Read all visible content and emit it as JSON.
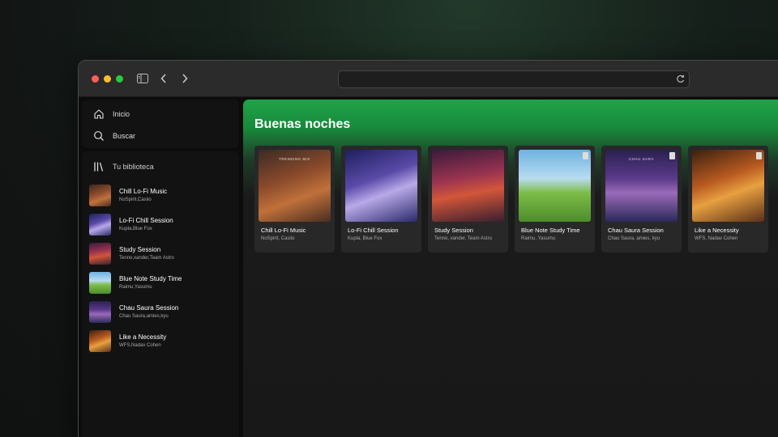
{
  "nav": {
    "home_label": "Inicio",
    "search_label": "Buscar"
  },
  "library": {
    "title": "Tu biblioteca",
    "items": [
      {
        "title": "Chill Lo-Fi Music",
        "subtitle": "NoSpirit,Casiio",
        "art": "art1"
      },
      {
        "title": "Lo-Fi Chill Session",
        "subtitle": "Kupla,Blue Fox",
        "art": "art2"
      },
      {
        "title": "Study Session",
        "subtitle": "Tenno,xander,Team Astro",
        "art": "art3"
      },
      {
        "title": "Blue Note Study Time",
        "subtitle": "Raimu,Yasumu",
        "art": "art4"
      },
      {
        "title": "Chau Saura Session",
        "subtitle": "Chau Saura,amies,kyu",
        "art": "art5"
      },
      {
        "title": "Like a Necessity",
        "subtitle": "WFS,Nadav Cohen",
        "art": "art6"
      }
    ]
  },
  "main": {
    "greeting": "Buenas noches",
    "cards": [
      {
        "title": "Chill Lo-Fi Music",
        "subtitle": "NoSpirit, Casiio",
        "art": "art1",
        "label": "TRENDING MIX",
        "badge": false
      },
      {
        "title": "Lo-Fi Chill Session",
        "subtitle": "Kupla, Blue Fox",
        "art": "art2",
        "label": "",
        "badge": false
      },
      {
        "title": "Study Session",
        "subtitle": "Tenno, xander, Team Astro",
        "art": "art3",
        "label": "",
        "badge": false
      },
      {
        "title": "Blue Note Study Time",
        "subtitle": "Raimu, Yasumu",
        "art": "art4",
        "label": "",
        "badge": true
      },
      {
        "title": "Chau Saura Session",
        "subtitle": "Chau Saura, amies, kyu",
        "art": "art5",
        "label": "CHAU SARA",
        "badge": true
      },
      {
        "title": "Like a Necessity",
        "subtitle": "WFS, Nadav Cohen",
        "art": "art6",
        "label": "",
        "badge": true
      }
    ]
  },
  "colors": {
    "accent": "#1db954",
    "background": "#121212"
  }
}
